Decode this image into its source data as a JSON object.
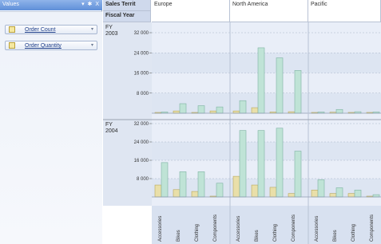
{
  "values_panel": {
    "title": "Values",
    "tools": "▾ ✱ X",
    "fields": [
      {
        "label": "Order Count"
      },
      {
        "label": "Order Quantity"
      }
    ]
  },
  "pivot": {
    "row_header_1": "Sales Territ",
    "row_header_2": "Fiscal Year",
    "regions": [
      "Europe",
      "North America",
      "Pacific"
    ],
    "years": [
      "FY 2003",
      "FY 2004"
    ]
  },
  "chart_data": {
    "type": "bar",
    "categories": [
      "Accessories",
      "Bikes",
      "Clothing",
      "Components"
    ],
    "regions": [
      "Europe",
      "North America",
      "Pacific"
    ],
    "years": [
      "FY 2003",
      "FY 2004"
    ],
    "yticks": [
      "32 000",
      "24 000",
      "16 000",
      "8 000"
    ],
    "ylim": [
      0,
      32000
    ],
    "series": [
      {
        "values": {
          "FY 2003": {
            "Europe": [
              0,
              900,
              0,
              900
            ],
            "North America": [
              900,
              2200,
              500,
              600
            ],
            "Pacific": [
              0,
              400,
              0,
              0
            ]
          },
          "FY 2004": {
            "Europe": [
              5200,
              3200,
              2400,
              0
            ],
            "North America": [
              9000,
              5200,
              4200,
              1500
            ],
            "Pacific": [
              3000,
              1500,
              1500,
              0
            ]
          }
        }
      },
      {
        "values": {
          "FY 2003": {
            "Europe": [
              500,
              3800,
              3000,
              2500
            ],
            "North America": [
              5000,
              26000,
              22000,
              17000
            ],
            "Pacific": [
              500,
              1500,
              600,
              500
            ]
          },
          "FY 2004": {
            "Europe": [
              15000,
              11000,
              11000,
              6000
            ],
            "North America": [
              29000,
              29000,
              30000,
              20000
            ],
            "Pacific": [
              7500,
              4000,
              3000,
              1000
            ]
          }
        }
      }
    ],
    "series_colors": [
      "#e9dfa9",
      "#bfe3d6"
    ],
    "grid": true
  }
}
